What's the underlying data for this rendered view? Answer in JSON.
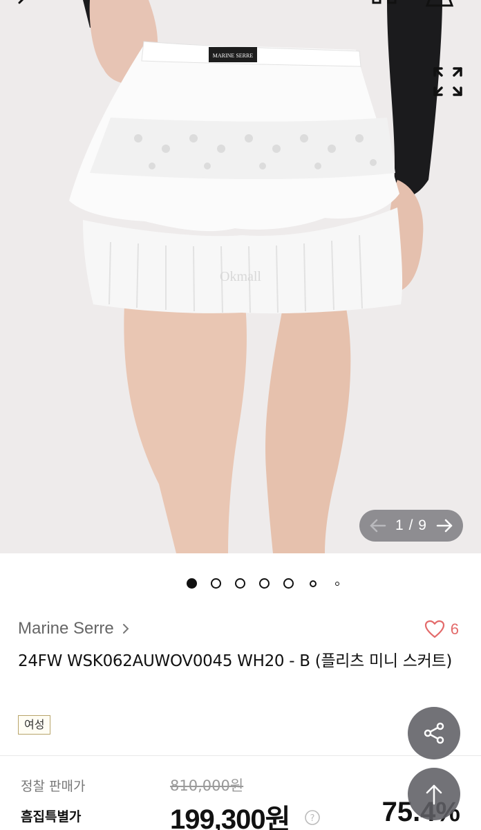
{
  "gallery": {
    "current": "1",
    "separator": "/",
    "total": "9",
    "watermark": "Okmall",
    "label_on_garment": "MARINE SERRE",
    "dots": 7,
    "active_dot": 0
  },
  "product": {
    "brand": "Marine Serre",
    "title": "24FW   WSK062AUWOV0045 WH20 - B (플리츠 미니 스커트)",
    "tag": "여성",
    "like_count": "6"
  },
  "pricing": {
    "regular_label": "정찰 판매가",
    "regular_price": "810,000원",
    "special_label": "흠집특별가",
    "special_price": "199,300원",
    "discount": "75.4%"
  },
  "colors": {
    "heart": "#e36a6a",
    "tag_border": "#b8a46a",
    "fab": "#5f5f64"
  },
  "icons": {
    "back": "chevron-left-icon",
    "expand": "expand-icon",
    "share": "share-icon",
    "scroll_top": "arrow-up-icon",
    "help": "question-circle-icon",
    "like": "heart-icon"
  }
}
